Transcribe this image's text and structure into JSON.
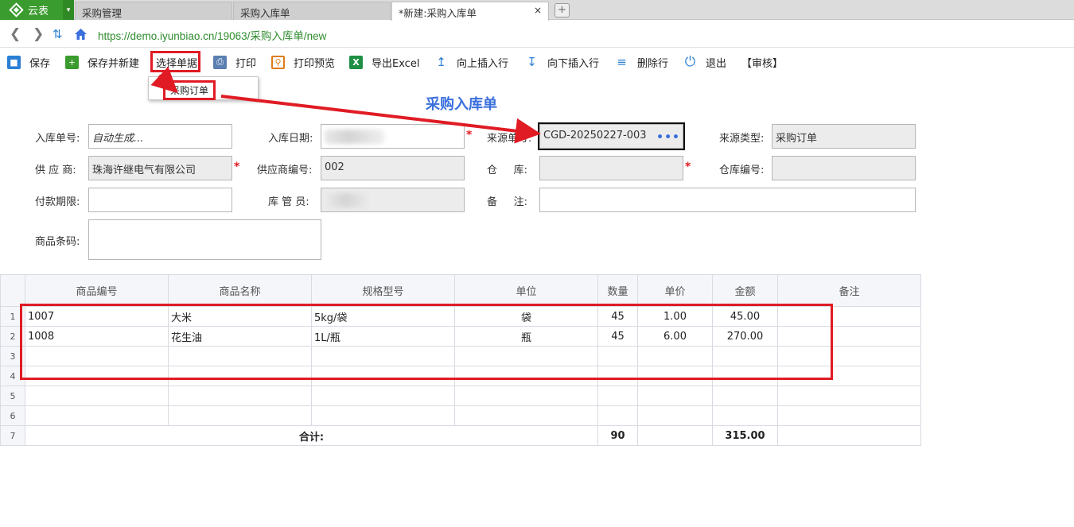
{
  "app": {
    "logo_label": "云表",
    "logo_dropdown": "▾"
  },
  "tabs": [
    {
      "label": "采购管理"
    },
    {
      "label": "采购入库单"
    },
    {
      "label": "*新建:采购入库单",
      "close": "×"
    }
  ],
  "tab_add": "+",
  "address": {
    "url": "https://demo.iyunbiao.cn/19063/采购入库单/new"
  },
  "toolbar": {
    "save": "保存",
    "save_new": "保存并新建",
    "select_data": "选择单据",
    "print": "打印",
    "print_preview": "打印预览",
    "export_excel": "导出Excel",
    "insert_above": "向上插入行",
    "insert_below": "向下插入行",
    "delete_row": "删除行",
    "exit": "退出",
    "audit": "【审核】"
  },
  "dropdown": {
    "item": "采购订单"
  },
  "form": {
    "title": "采购入库单",
    "receipt_no": {
      "label": "入库单号:",
      "value": "自动生成..."
    },
    "receipt_date": {
      "label": "入库日期:",
      "value": ""
    },
    "source_no": {
      "label": "来源单号:",
      "value": "CGD-20250227-003"
    },
    "source_type": {
      "label": "来源类型:",
      "value": "采购订单"
    },
    "supplier": {
      "label": "供 应 商:",
      "value": "珠海许继电气有限公司"
    },
    "supplier_code": {
      "label": "供应商编号:",
      "value": "002"
    },
    "warehouse": {
      "label": "仓 库:",
      "value": ""
    },
    "warehouse_code": {
      "label": "仓库编号:",
      "value": ""
    },
    "payment_term": {
      "label": "付款期限:",
      "value": ""
    },
    "keeper": {
      "label": "库 管 员:",
      "value": ""
    },
    "remark": {
      "label": "备 注:",
      "value": ""
    },
    "barcode": {
      "label": "商品条码:",
      "value": ""
    },
    "required_mark": "*"
  },
  "grid": {
    "headers": [
      "商品编号",
      "商品名称",
      "规格型号",
      "单位",
      "数量",
      "单价",
      "金额",
      "备注"
    ],
    "rows": [
      {
        "num": "1",
        "code": "1007",
        "name": "大米",
        "spec": "5kg/袋",
        "unit": "袋",
        "qty": "45",
        "price": "1.00",
        "amount": "45.00",
        "note": ""
      },
      {
        "num": "2",
        "code": "1008",
        "name": "花生油",
        "spec": "1L/瓶",
        "unit": "瓶",
        "qty": "45",
        "price": "6.00",
        "amount": "270.00",
        "note": ""
      },
      {
        "num": "3",
        "code": "",
        "name": "",
        "spec": "",
        "unit": "",
        "qty": "",
        "price": "",
        "amount": "",
        "note": ""
      },
      {
        "num": "4",
        "code": "",
        "name": "",
        "spec": "",
        "unit": "",
        "qty": "",
        "price": "",
        "amount": "",
        "note": ""
      },
      {
        "num": "5",
        "code": "",
        "name": "",
        "spec": "",
        "unit": "",
        "qty": "",
        "price": "",
        "amount": "",
        "note": ""
      },
      {
        "num": "6",
        "code": "",
        "name": "",
        "spec": "",
        "unit": "",
        "qty": "",
        "price": "",
        "amount": "",
        "note": ""
      }
    ],
    "total": {
      "num": "7",
      "label": "合计:",
      "qty": "90",
      "amount": "315.00"
    }
  },
  "colors": {
    "accent": "#3a6fdc",
    "highlight": "#e01b24",
    "brand": "#3a9b2e"
  }
}
